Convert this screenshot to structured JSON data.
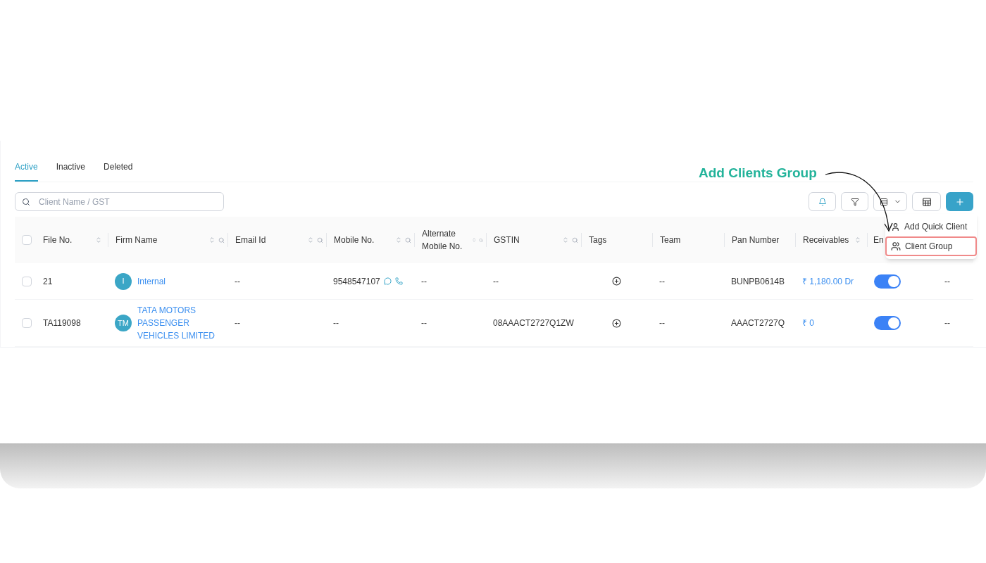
{
  "tabs": [
    {
      "label": "Active",
      "selected": true
    },
    {
      "label": "Inactive",
      "selected": false
    },
    {
      "label": "Deleted",
      "selected": false
    }
  ],
  "search": {
    "placeholder": "Client Name / GST"
  },
  "annotation": {
    "text": "Add Clients Group"
  },
  "table": {
    "all_checked": false,
    "columns": [
      {
        "label": "File No.",
        "sort": true,
        "search": false
      },
      {
        "label": "Firm Name",
        "sort": true,
        "search": true
      },
      {
        "label": "Email Id",
        "sort": true,
        "search": true
      },
      {
        "label": "Mobile No.",
        "sort": true,
        "search": true
      },
      {
        "label": "Alternate Mobile No.",
        "sort": true,
        "search": true
      },
      {
        "label": "GSTIN",
        "sort": true,
        "search": true
      },
      {
        "label": "Tags",
        "sort": false,
        "search": false
      },
      {
        "label": "Team",
        "sort": false,
        "search": false
      },
      {
        "label": "Pan Number",
        "sort": false,
        "search": false
      },
      {
        "label": "Receivables",
        "sort": true,
        "search": false
      },
      {
        "label": "En",
        "sort": false,
        "search": false
      }
    ],
    "rows": [
      {
        "checked": false,
        "file_no": "21",
        "initials": "I",
        "firm_name": "Internal",
        "email": "--",
        "mobile": "9548547107",
        "contact_icons": true,
        "alternate": "--",
        "gstin": "--",
        "team": "--",
        "pan": "BUNPB0614B",
        "receivables": "₹ 1,180.00 Dr",
        "enabled": true,
        "column_13": "--"
      },
      {
        "checked": false,
        "file_no": "TA119098",
        "initials": "TM",
        "firm_name": "TATA MOTORS PASSENGER VEHICLES LIMITED",
        "email": "--",
        "mobile": "--",
        "contact_icons": false,
        "alternate": "--",
        "gstin": "08AAACT2727Q1ZW",
        "team": "--",
        "pan": "AAACT2727Q",
        "receivables": "₹ 0",
        "enabled": true,
        "column_13": "--"
      }
    ]
  },
  "menu": {
    "items": [
      {
        "kind": "person",
        "label": "Add Quick Client",
        "highlighted": false
      },
      {
        "kind": "group",
        "label": "Client Group",
        "highlighted": true
      }
    ]
  }
}
